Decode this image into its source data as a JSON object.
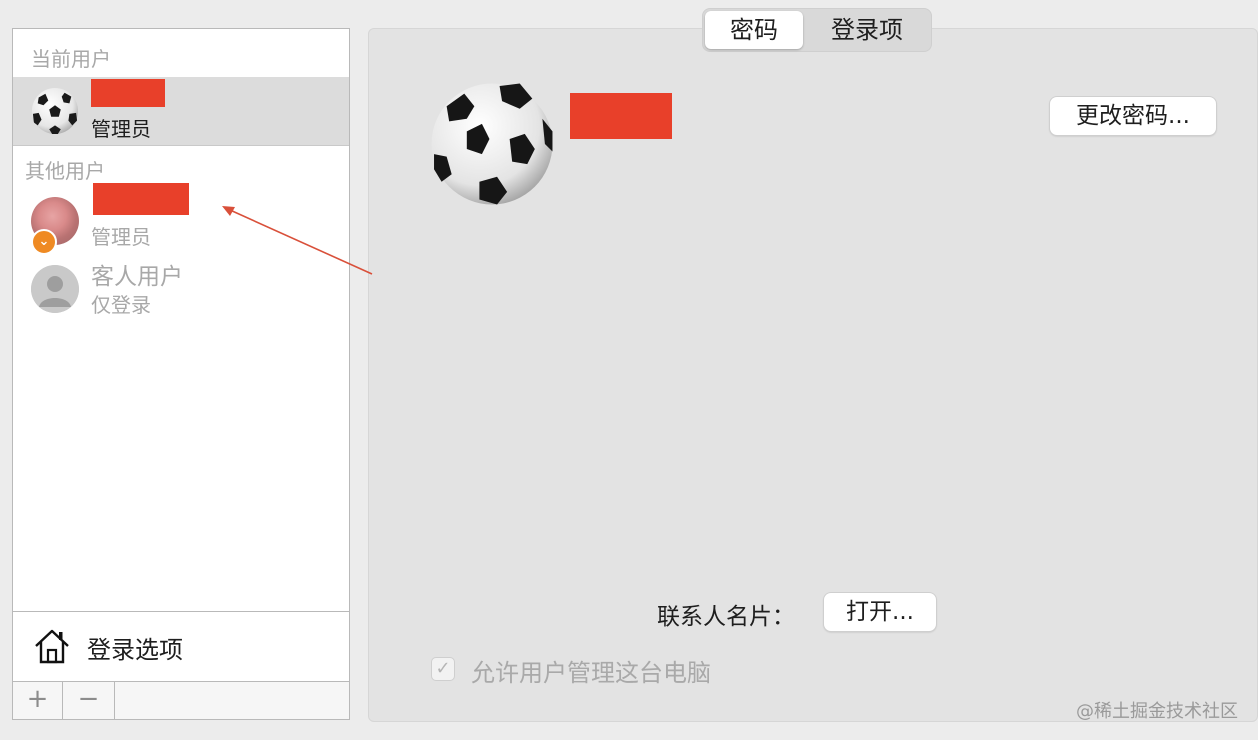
{
  "tabs": [
    {
      "label": "密码",
      "active": true
    },
    {
      "label": "登录项",
      "active": false
    }
  ],
  "sidebar": {
    "current_users_header": "当前用户",
    "current_user": {
      "role": "管理员"
    },
    "other_users_header": "其他用户",
    "other_users": [
      {
        "role": "管理员",
        "has_badge": true
      },
      {
        "name": "客人用户",
        "role": "仅登录"
      }
    ],
    "login_options_label": "登录选项",
    "add_button": "+",
    "remove_button": "−"
  },
  "main": {
    "change_password_button": "更改密码...",
    "contact_card_label": "联系人名片：",
    "open_button": "打开...",
    "allow_admin_label": "允许用户管理这台电脑",
    "allow_admin_checked": true
  },
  "watermark": "@稀土掘金技术社区",
  "colors": {
    "redaction": "#e8402a",
    "badge": "#ef8a23",
    "annotation_arrow": "#d9503a"
  }
}
